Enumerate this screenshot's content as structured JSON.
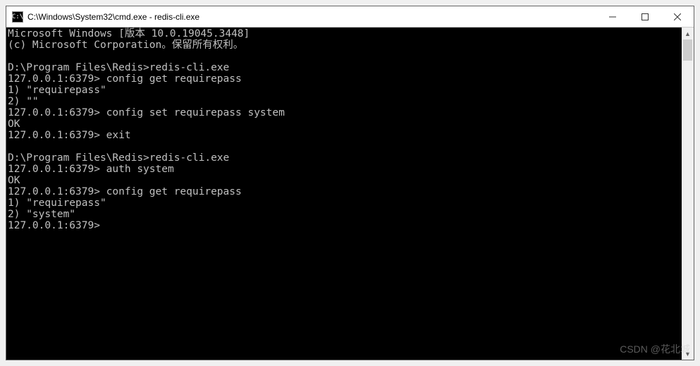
{
  "titlebar": {
    "icon_label": "C:\\",
    "title": "C:\\Windows\\System32\\cmd.exe - redis-cli.exe"
  },
  "window_controls": {
    "minimize": "minimize",
    "maximize": "maximize",
    "close": "close"
  },
  "console": {
    "lines": [
      "Microsoft Windows [版本 10.0.19045.3448]",
      "(c) Microsoft Corporation。保留所有权利。",
      "",
      "D:\\Program Files\\Redis>redis-cli.exe",
      "127.0.0.1:6379> config get requirepass",
      "1) \"requirepass\"",
      "2) \"\"",
      "127.0.0.1:6379> config set requirepass system",
      "OK",
      "127.0.0.1:6379> exit",
      "",
      "D:\\Program Files\\Redis>redis-cli.exe",
      "127.0.0.1:6379> auth system",
      "OK",
      "127.0.0.1:6379> config get requirepass",
      "1) \"requirepass\"",
      "2) \"system\"",
      "127.0.0.1:6379>"
    ]
  },
  "watermark": "CSDN @花北城"
}
